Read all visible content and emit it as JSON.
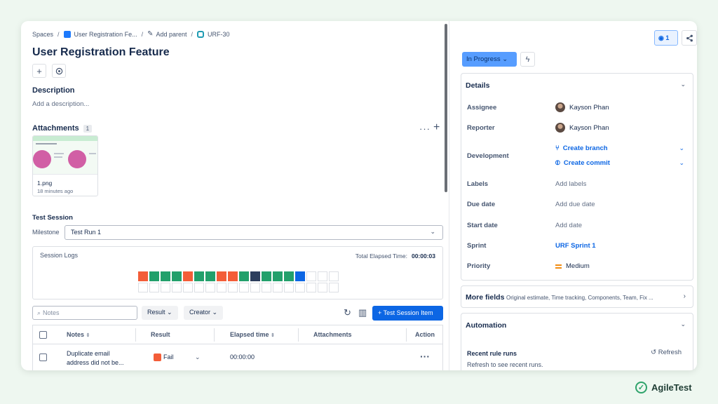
{
  "breadcrumb": {
    "spaces": "Spaces",
    "parent_issue": "User Registration Fe...",
    "add_parent": "Add parent",
    "issue_key": "URF-30"
  },
  "issue": {
    "title": "User Registration Feature"
  },
  "description": {
    "label": "Description",
    "placeholder": "Add a description..."
  },
  "attachments": {
    "label": "Attachments",
    "count": "1",
    "files": [
      {
        "name": "1.png",
        "time": "18 minutes ago"
      }
    ]
  },
  "test_session": {
    "label": "Test Session",
    "milestone_label": "Milestone",
    "milestone_value": "Test Run 1",
    "logs_title": "Session Logs",
    "elapsed_label": "Total Elapsed Time:",
    "elapsed_value": "00:00:03",
    "log_cells": [
      "#f35d38",
      "#22a06b",
      "#22a06b",
      "#22a06b",
      "#f35d38",
      "#22a06b",
      "#22a06b",
      "#f35d38",
      "#f35d38",
      "#22a06b",
      "#2c3e5d",
      "#22a06b",
      "#22a06b",
      "#22a06b",
      "#0c66e4",
      "#ffffff",
      "#ffffff",
      "#ffffff",
      "#ffffff",
      "#ffffff",
      "#ffffff",
      "#ffffff",
      "#ffffff",
      "#ffffff",
      "#ffffff",
      "#ffffff",
      "#ffffff",
      "#ffffff",
      "#ffffff",
      "#ffffff",
      "#ffffff",
      "#ffffff",
      "#ffffff",
      "#ffffff",
      "#ffffff",
      "#ffffff"
    ]
  },
  "toolbar": {
    "notes_placeholder": "Notes",
    "result_label": "Result",
    "creator_label": "Creator",
    "add_item_label": "+ Test Session Item"
  },
  "table": {
    "headers": [
      "Notes",
      "Result",
      "Elapsed time",
      "Attachments",
      "Action"
    ],
    "rows": [
      {
        "notes_line1": "Duplicate email",
        "notes_line2": "address did not be...",
        "result": "Fail",
        "elapsed": "00:00:00"
      }
    ]
  },
  "right_panel": {
    "watch_count": "1",
    "status": "In Progress",
    "details_title": "Details",
    "fields": {
      "assignee_label": "Assignee",
      "assignee_value": "Kayson Phan",
      "reporter_label": "Reporter",
      "reporter_value": "Kayson Phan",
      "development_label": "Development",
      "create_branch": "Create branch",
      "create_commit": "Create commit",
      "labels_label": "Labels",
      "labels_value": "Add labels",
      "due_label": "Due date",
      "due_value": "Add due date",
      "start_label": "Start date",
      "start_value": "Add date",
      "sprint_label": "Sprint",
      "sprint_value": "URF Sprint 1",
      "priority_label": "Priority",
      "priority_value": "Medium"
    },
    "more_fields_title": "More fields",
    "more_fields_sub": "Original estimate, Time tracking, Components, Team, Fix ...",
    "automation_title": "Automation",
    "recent_runs": "Recent rule runs",
    "refresh_label": "Refresh",
    "refresh_hint": "Refresh to see recent runs."
  },
  "brand": {
    "name": "AgileTest"
  },
  "colors": {
    "primary": "#0c66e4",
    "fail": "#f35d38",
    "pass": "#22a06b",
    "status": "#579dff"
  }
}
